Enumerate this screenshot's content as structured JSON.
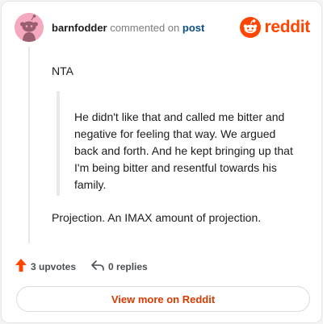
{
  "header": {
    "username": "barnfodder",
    "commented_text": "commented on",
    "post_link": "post"
  },
  "brand": {
    "icon": "reddit-snoo-icon",
    "wordmark": "reddit",
    "color": "#ff4500"
  },
  "comment": {
    "paragraph_1": "NTA",
    "quote": "He didn't like that and called me bitter and negative for feeling that way. We argued back and forth. And he kept bringing up that I'm being bitter and resentful towards his family.",
    "paragraph_2": "Projection. An IMAX amount of projection."
  },
  "actions": {
    "upvotes_label": "3 upvotes",
    "upvote_icon": "upvote-arrow-icon",
    "replies_label": "0 replies",
    "reply_icon": "reply-arrow-icon"
  },
  "footer": {
    "view_more_label": "View more on Reddit"
  },
  "colors": {
    "accent": "#ff4500",
    "link": "#0b4f8a",
    "avatar_bg": "#f4a9bf"
  }
}
